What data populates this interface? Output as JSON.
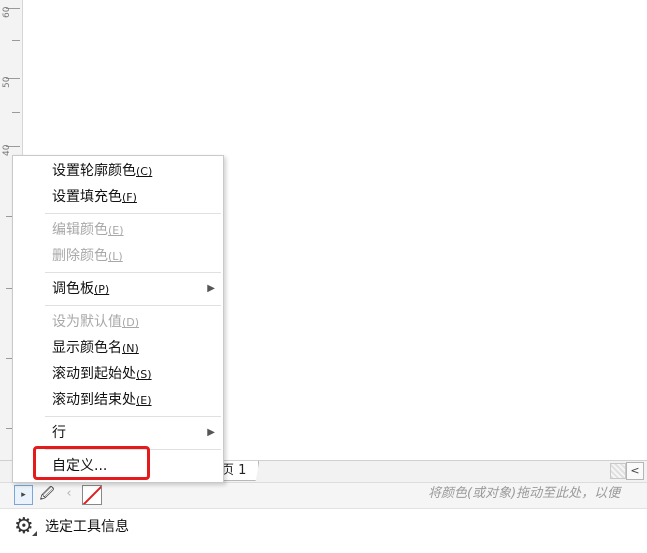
{
  "ruler": {
    "labels": [
      "60",
      "50",
      "40"
    ]
  },
  "page_tab": {
    "label": "页 1"
  },
  "palette": {
    "expand_glyph": "▸",
    "dropper_glyph": "🖉",
    "arrow_glyph": "‹",
    "drag_hint": "将颜色(或对象)拖动至此处，以便"
  },
  "scroll": {
    "left_glyph": "<"
  },
  "status": {
    "tool_info": "选定工具信息"
  },
  "context_menu": {
    "set_outline_color": {
      "text": "设置轮廓颜色",
      "accel": "(C)"
    },
    "set_fill_color": {
      "text": "设置填充色",
      "accel": "(F)"
    },
    "edit_color": {
      "text": "编辑颜色",
      "accel": "(E)"
    },
    "delete_color": {
      "text": "删除颜色",
      "accel": "(L)"
    },
    "palette": {
      "text": "调色板",
      "accel": "(P)"
    },
    "set_default": {
      "text": "设为默认值",
      "accel": "(D)"
    },
    "show_color_names": {
      "text": "显示颜色名",
      "accel": "(N)"
    },
    "scroll_to_start": {
      "text": "滚动到起始处",
      "accel": "(S)"
    },
    "scroll_to_end": {
      "text": "滚动到结束处",
      "accel": "(E)"
    },
    "rows": {
      "text": "行"
    },
    "customize": {
      "text": "自定义..."
    }
  },
  "colors": {
    "highlight": "#e51a1a",
    "no_color_slash": "#e02020"
  }
}
